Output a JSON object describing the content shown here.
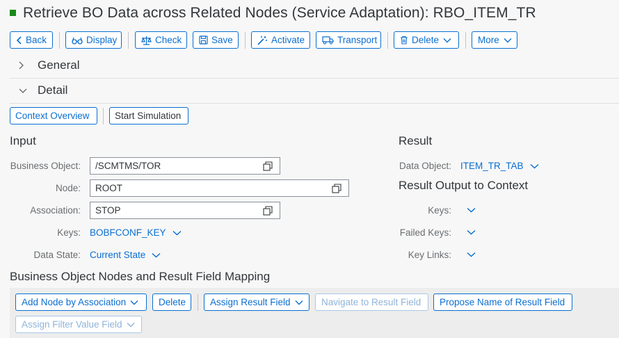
{
  "title": "Retrieve BO Data across Related Nodes (Service Adaptation): RBO_ITEM_TR",
  "colors": {
    "accent": "#0a6ed1",
    "status": "#188918"
  },
  "toolbar": {
    "back": "Back",
    "display": "Display",
    "check": "Check",
    "save": "Save",
    "activate": "Activate",
    "transport": "Transport",
    "delete": "Delete",
    "more": "More"
  },
  "sections": {
    "general": "General",
    "detail": "Detail"
  },
  "detail_toolbar": {
    "context_overview": "Context Overview",
    "start_simulation": "Start Simulation"
  },
  "input": {
    "heading": "Input",
    "business_object": {
      "label": "Business Object:",
      "value": "/SCMTMS/TOR"
    },
    "node": {
      "label": "Node:",
      "value": "ROOT"
    },
    "association": {
      "label": "Association:",
      "value": "STOP"
    },
    "keys": {
      "label": "Keys:",
      "value": "BOBFCONF_KEY"
    },
    "data_state": {
      "label": "Data State:",
      "value": "Current State"
    }
  },
  "result": {
    "heading": "Result",
    "data_object": {
      "label": "Data Object:",
      "value": "ITEM_TR_TAB"
    },
    "output_heading": "Result Output to Context",
    "keys_label": "Keys:",
    "failed_keys_label": "Failed Keys:",
    "key_links_label": "Key Links:"
  },
  "mapping": {
    "heading": "Business Object Nodes and Result Field Mapping",
    "add_node": "Add Node by Association",
    "delete": "Delete",
    "assign_result_field": "Assign Result Field",
    "navigate_result_field": "Navigate to Result Field",
    "propose_name": "Propose Name of Result Field",
    "assign_filter": "Assign Filter Value Field"
  }
}
